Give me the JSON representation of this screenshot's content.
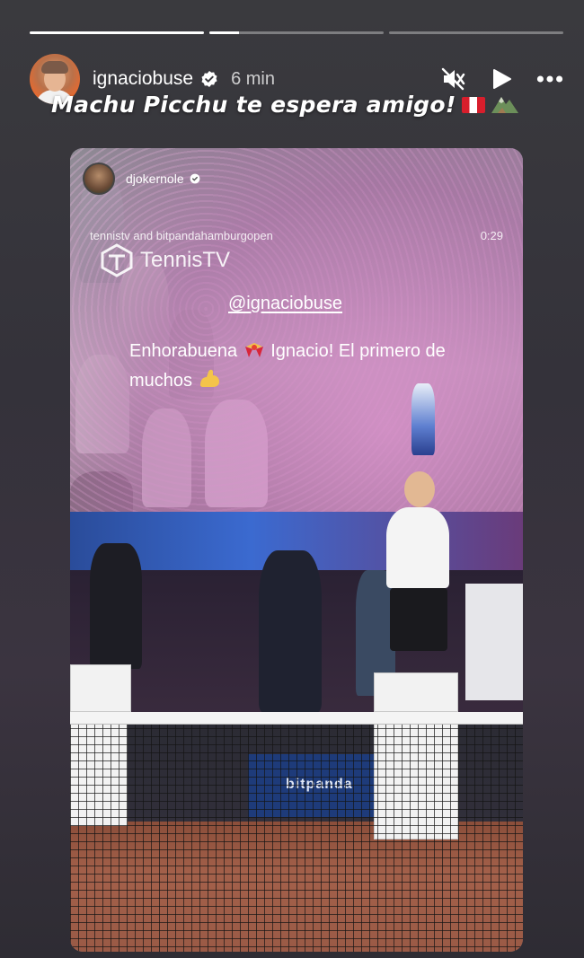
{
  "progress": [
    1.0,
    0.17,
    0.0
  ],
  "header": {
    "username": "ignaciobuse",
    "time": "6 min",
    "icons": [
      "mute-icon",
      "play-icon",
      "more-icon"
    ]
  },
  "caption": {
    "text": "Machu Picchu te espera amigo!",
    "emojis": [
      "peru-flag-icon",
      "mountain-icon"
    ]
  },
  "post": {
    "author": "djokernole",
    "credit": "tennistv and bitpandahamburgopen",
    "duration": "0:29",
    "logo_text": "TennisTV",
    "mention": "@ignaciobuse",
    "message_line1_a": "Enhorabuena",
    "message_line1_b": "Ignacio! El primero de",
    "message_line2": "muchos",
    "banner_text": "bitpanda"
  },
  "colors": {
    "background": "#36343a",
    "accent_confetti": "#c88cc0",
    "verified": "#ffffff"
  }
}
